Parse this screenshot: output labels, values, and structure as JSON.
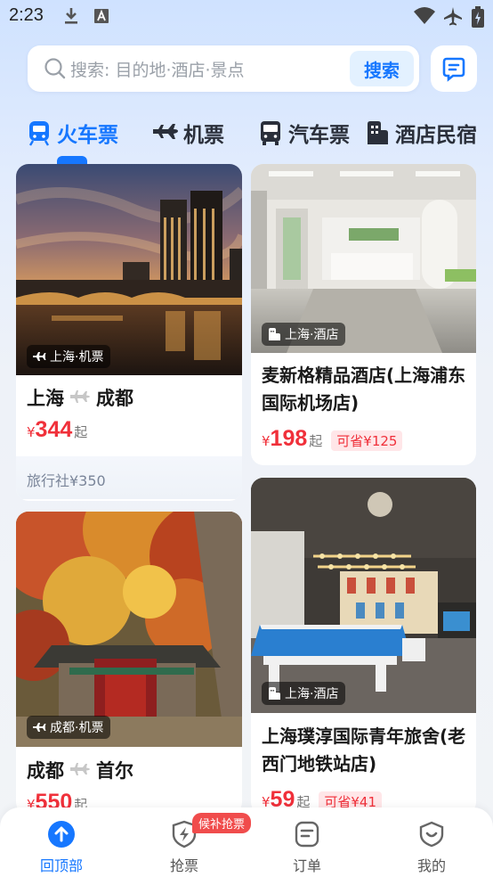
{
  "status_bar": {
    "time": "2:23"
  },
  "search": {
    "placeholder": "搜索: 目的地·酒店·景点",
    "button": "搜索"
  },
  "tabs": [
    {
      "label": "火车票",
      "icon": "train-icon",
      "active": true
    },
    {
      "label": "机票",
      "icon": "plane-icon"
    },
    {
      "label": "汽车票",
      "icon": "bus-icon"
    },
    {
      "label": "酒店民宿",
      "icon": "hotel-icon"
    }
  ],
  "cards": {
    "c1": {
      "badge": "上海·机票",
      "from": "上海",
      "to": "成都",
      "yen": "¥",
      "price": "344",
      "suffix": "起",
      "agency": "旅行社¥350"
    },
    "c2": {
      "badge": "上海·酒店",
      "name": "麦新格精品酒店(上海浦东国际机场店)",
      "yen": "¥",
      "price": "198",
      "suffix": "起",
      "save": "可省¥125"
    },
    "c3": {
      "badge": "成都·机票",
      "from": "成都",
      "to": "首尔",
      "yen": "¥",
      "price": "550",
      "suffix": "起"
    },
    "c4": {
      "badge": "上海·酒店",
      "name": "上海璞淳国际青年旅舍(老西门地铁站店)",
      "yen": "¥",
      "price": "59",
      "suffix": "起",
      "save": "可省¥41"
    }
  },
  "bottom_nav": {
    "items": [
      {
        "label": "回顶部",
        "icon": "arrow-up-icon",
        "active": true
      },
      {
        "label": "抢票",
        "icon": "lightning-icon"
      },
      {
        "label": "订单",
        "icon": "order-icon"
      },
      {
        "label": "我的",
        "icon": "profile-icon"
      }
    ],
    "badge": "候补抢票"
  },
  "colors": {
    "accent": "#1677ff",
    "price": "#f0303a"
  }
}
